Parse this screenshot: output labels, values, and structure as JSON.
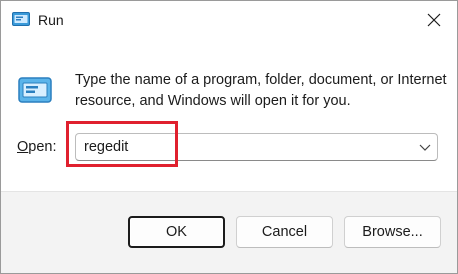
{
  "window": {
    "title": "Run",
    "title_icon": "run-icon",
    "close_icon": "close-icon"
  },
  "dialog": {
    "description": "Type the name of a program, folder, document, or Internet resource, and Windows will open it for you.",
    "app_icon": "run-app-icon",
    "open_label": "Open:",
    "open_label_access_key": "O",
    "open_value": "regedit",
    "dropdown_icon": "chevron-down-icon",
    "highlight_color": "#e0202e"
  },
  "buttons": {
    "ok_label": "OK",
    "cancel_label": "Cancel",
    "browse_label": "Browse..."
  }
}
